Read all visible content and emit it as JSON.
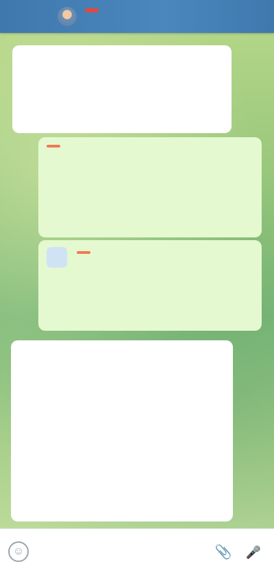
{
  "header": {
    "title": ""
  },
  "messages": [
    {
      "direction": "in",
      "paragraphs": [],
      "time": ""
    },
    {
      "direction": "out",
      "sender": "",
      "paragraphs": [],
      "time": ""
    },
    {
      "direction": "out",
      "sender": "",
      "paragraphs": [],
      "time": ""
    },
    {
      "direction": "in",
      "paragraphs": [],
      "time": ""
    }
  ],
  "input": {
    "placeholder": ""
  },
  "icons": {
    "emoji": "smile-icon",
    "attach": "paperclip-icon",
    "mic": "microphone-icon"
  },
  "colors": {
    "header": "#4a87bd",
    "title_badge": "#e0493e",
    "sender_badge": "#ef7a55",
    "outgoing_bubble": "#e5f9d0",
    "incoming_bubble": "#ffffff"
  }
}
